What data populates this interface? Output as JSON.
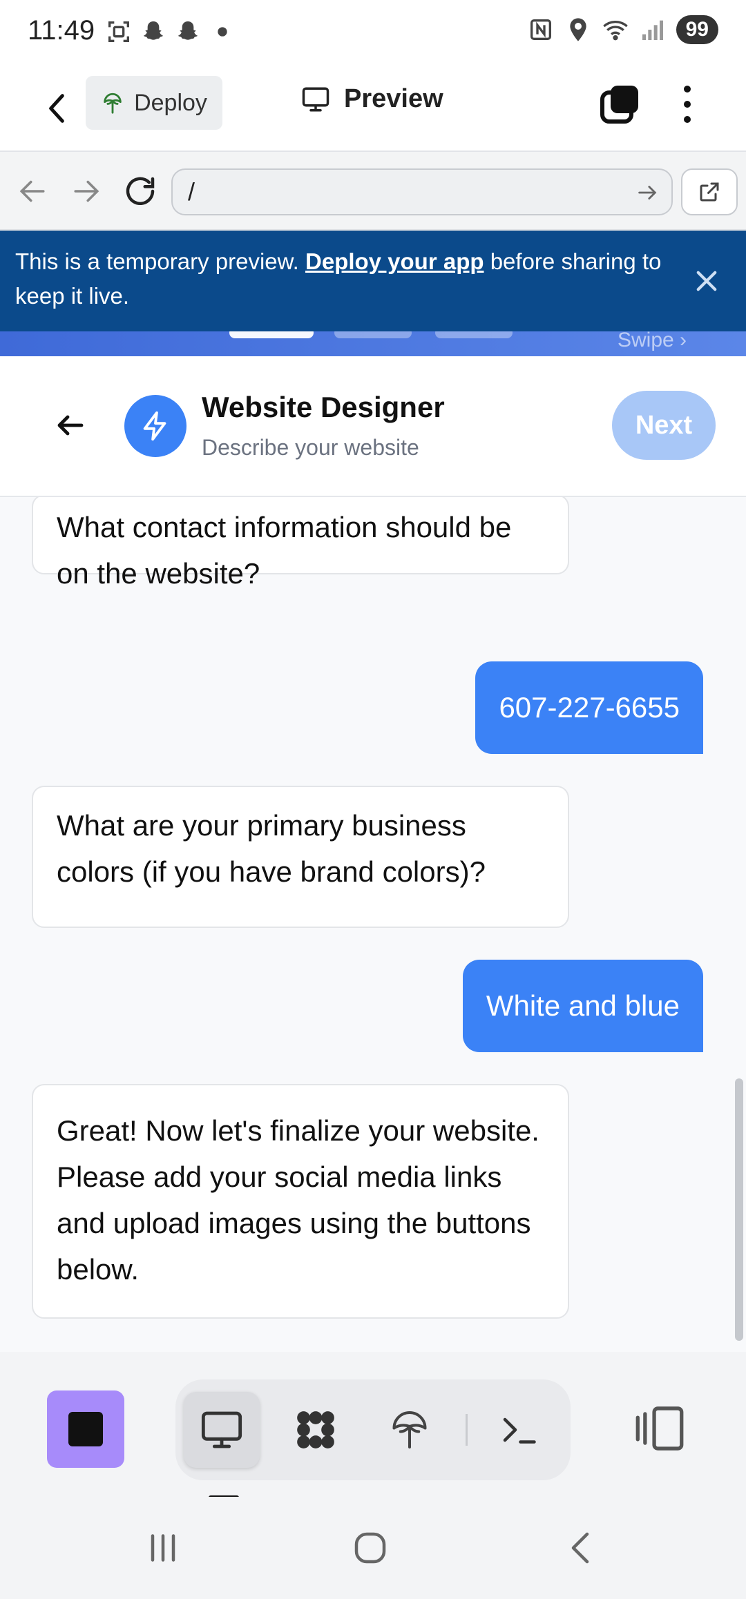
{
  "status_bar": {
    "time": "11:49",
    "battery": "99",
    "left_icons": [
      "screenshot-icon",
      "snapchat-icon",
      "snapchat-icon",
      "dot-icon"
    ],
    "right_icons": [
      "nfc-icon",
      "location-icon",
      "wifi-icon",
      "signal-icon"
    ]
  },
  "app_bar": {
    "deploy_label": "Deploy",
    "preview_label": "Preview"
  },
  "browser": {
    "url": "/"
  },
  "banner": {
    "text_before": "This is a temporary preview. ",
    "link_text": "Deploy your app",
    "text_after": " before sharing to keep it live."
  },
  "strip": {
    "swipe_label": "Swipe ›"
  },
  "designer": {
    "title": "Website Designer",
    "subtitle": "Describe your website",
    "next_label": "Next"
  },
  "chat": {
    "messages": [
      {
        "role": "bot",
        "text": "What contact information should be on the website?"
      },
      {
        "role": "user",
        "text": "607-227-6655"
      },
      {
        "role": "bot",
        "text": "What are your primary business colors (if you have brand colors)?"
      },
      {
        "role": "user",
        "text": "White and blue"
      },
      {
        "role": "bot",
        "text": "Great! Now let's finalize your website. Please add your social media links and upload images using the buttons below."
      }
    ]
  },
  "toolbar": {
    "tools": [
      "monitor-icon",
      "apps-icon",
      "deploy-icon",
      "terminal-icon"
    ]
  },
  "colors": {
    "banner_bg": "#0b4a8b",
    "accent": "#3b82f6",
    "next_disabled": "#a8c7f7",
    "stop_bg": "#a78bfa"
  }
}
